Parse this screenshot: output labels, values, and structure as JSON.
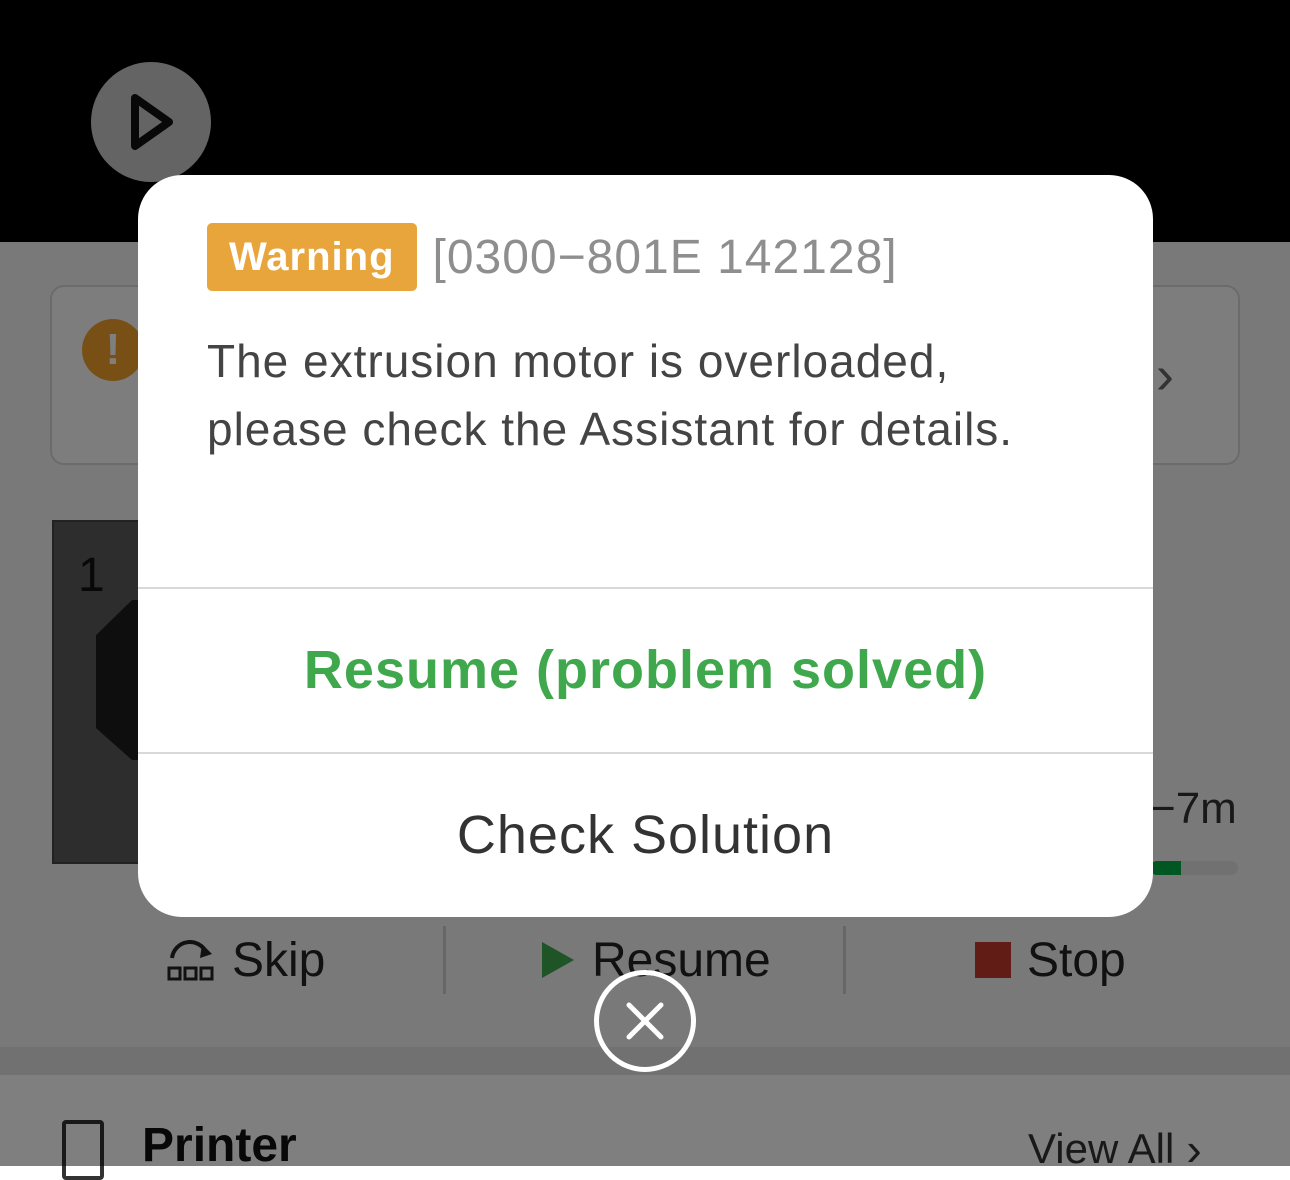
{
  "background": {
    "task_number": "1",
    "time_remaining": "−7m",
    "progress": 0.35,
    "controls": {
      "skip_label": "Skip",
      "resume_label": "Resume",
      "stop_label": "Stop"
    },
    "printer_section": {
      "title": "Printer",
      "view_all_label": "View All"
    },
    "notice_icon_text": "!",
    "colors": {
      "progress": "#00ae42",
      "stop": "#c0392b",
      "resume": "#3fa84c"
    }
  },
  "dialog": {
    "badge_label": "Warning",
    "error_code": "[0300−801E 142128]",
    "message": "The extrusion motor is overloaded, please check the Assistant for details.",
    "primary_button_label": "Resume (problem solved)",
    "secondary_button_label": "Check Solution",
    "colors": {
      "badge": "#e8a53b",
      "primary": "#3fa84c"
    }
  }
}
